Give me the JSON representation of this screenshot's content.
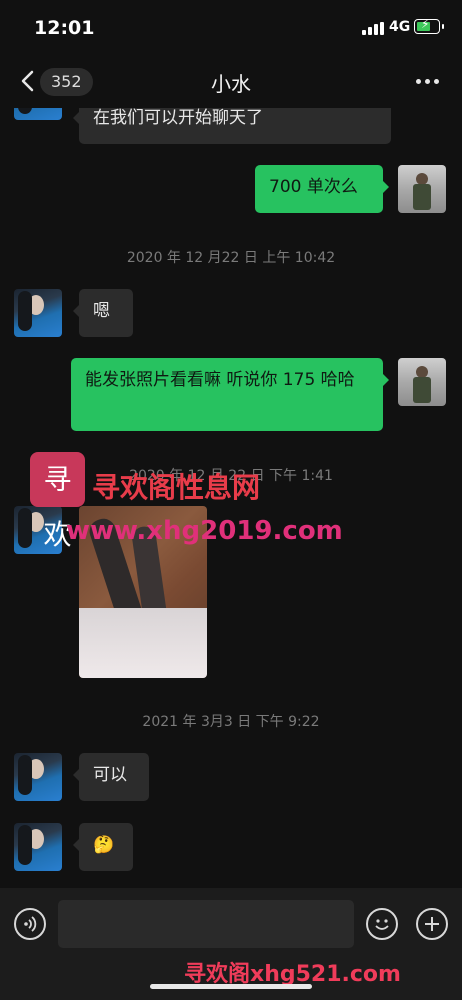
{
  "status": {
    "time": "12:01",
    "network": "4G"
  },
  "header": {
    "back_count": "352",
    "title": "小水"
  },
  "messages": [
    {
      "text": "在我们可以开始聊天了"
    },
    {
      "text": "700 单次么"
    },
    {
      "stamp": "2020 年 12 月22 日 上午 10:42"
    },
    {
      "text": "嗯"
    },
    {
      "text": "能发张照片看看嘛 听说你 175 哈哈"
    },
    {
      "stamp": "2020 年 12 月 22 日 下午 1:41"
    },
    {
      "stamp": "2021 年 3月3 日 下午 9:22"
    },
    {
      "text": "可以"
    },
    {
      "text": "🤔"
    }
  ],
  "watermark": {
    "logo": "寻欢",
    "text": "寻欢阁性息网",
    "url": "www.xhg2019.com",
    "bottom": "寻欢阁xhg521.com"
  },
  "composer": {
    "placeholder": ""
  },
  "colors": {
    "background": "#111111",
    "incoming_bubble": "#2c2c2c",
    "outgoing_bubble": "#27c260"
  }
}
